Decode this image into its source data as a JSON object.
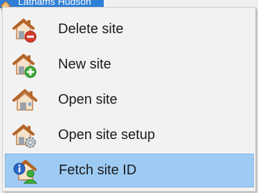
{
  "underlying": {
    "selected_text": "Lathams Hudson",
    "selection_color": "#2f7fd6"
  },
  "menu": {
    "items": [
      {
        "label": "Delete site",
        "icon": "site-delete-icon",
        "badge_color": "#d63b2a"
      },
      {
        "label": "New site",
        "icon": "site-new-icon",
        "badge_color": "#3fae3a"
      },
      {
        "label": "Open site",
        "icon": "site-open-icon",
        "badge_color": ""
      },
      {
        "label": "Open site setup",
        "icon": "site-setup-icon",
        "badge_color": "#9aa1a8"
      },
      {
        "label": "Fetch site ID",
        "icon": "site-fetch-id-icon",
        "badge_color": "#2a66c9"
      }
    ],
    "active_index": 4,
    "highlight_color": "#9ecbf4"
  }
}
